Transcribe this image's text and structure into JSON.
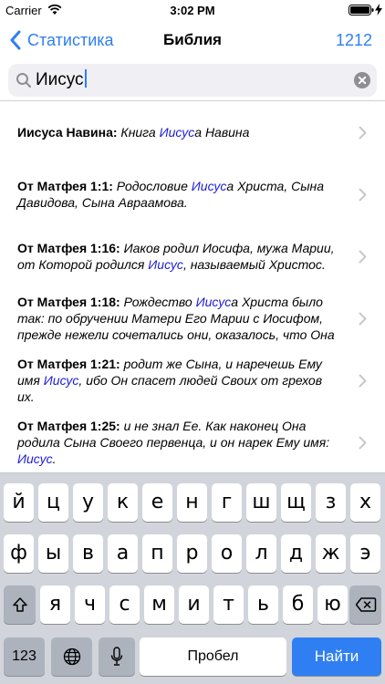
{
  "status": {
    "carrier": "Carrier",
    "time": "3:02 PM",
    "icons": [
      "wifi-icon",
      "battery-icon",
      "charging-icon"
    ]
  },
  "nav": {
    "back_label": "Статистика",
    "title": "Библия",
    "count": "1212"
  },
  "search": {
    "value": "Иисус",
    "icons": [
      "search-icon",
      "clear-icon"
    ]
  },
  "results": [
    {
      "ref": "Иисуса Навина:",
      "lines": [
        [
          {
            "t": " Книга ",
            "hl": false
          },
          {
            "t": "Иисус",
            "hl": true
          },
          {
            "t": "а Навина",
            "hl": false
          }
        ]
      ]
    },
    {
      "ref": "От Матфея 1:1:",
      "lines": [
        [
          {
            "t": " Родословие ",
            "hl": false
          },
          {
            "t": "Иисус",
            "hl": true
          },
          {
            "t": "а Христа, Сына",
            "hl": false
          }
        ],
        [
          {
            "t": "Давидова, Сына Авраамова.",
            "hl": false
          }
        ]
      ]
    },
    {
      "ref": "От Матфея 1:16:",
      "lines": [
        [
          {
            "t": " Иаков родил Иосифа, мужа Марии,",
            "hl": false
          }
        ],
        [
          {
            "t": "от Которой родился ",
            "hl": false
          },
          {
            "t": "Иисус",
            "hl": true
          },
          {
            "t": ", называемый Христос.",
            "hl": false
          }
        ]
      ]
    },
    {
      "ref": "От Матфея 1:18:",
      "lines": [
        [
          {
            "t": " Рождество ",
            "hl": false
          },
          {
            "t": "Иисус",
            "hl": true
          },
          {
            "t": "а Христа было",
            "hl": false
          }
        ],
        [
          {
            "t": "так: по обручении Матери Его Марии с Иосифом,",
            "hl": false
          }
        ],
        [
          {
            "t": "прежде нежели сочетались они, оказалось, что Она",
            "hl": false
          }
        ]
      ]
    },
    {
      "ref": "От Матфея 1:21:",
      "lines": [
        [
          {
            "t": " родит же Сына, и наречешь Ему",
            "hl": false
          }
        ],
        [
          {
            "t": "имя ",
            "hl": false
          },
          {
            "t": "Иисус",
            "hl": true
          },
          {
            "t": ", ибо Он спасет людей Своих от грехов",
            "hl": false
          }
        ],
        [
          {
            "t": "их.",
            "hl": false
          }
        ]
      ]
    },
    {
      "ref": "От Матфея 1:25:",
      "lines": [
        [
          {
            "t": " и не знал Ее. Как наконец Она",
            "hl": false
          }
        ],
        [
          {
            "t": "родила Сына Своего первенца, и он нарек Ему имя:",
            "hl": false
          }
        ],
        [
          {
            "t": "Иисус",
            "hl": true
          },
          {
            "t": ".",
            "hl": false
          }
        ]
      ]
    }
  ],
  "keyboard": {
    "row1": [
      "й",
      "ц",
      "у",
      "к",
      "е",
      "н",
      "г",
      "ш",
      "щ",
      "з",
      "х"
    ],
    "row2": [
      "ф",
      "ы",
      "в",
      "а",
      "п",
      "р",
      "о",
      "л",
      "д",
      "ж",
      "э"
    ],
    "row3": [
      "я",
      "ч",
      "с",
      "м",
      "и",
      "т",
      "ь",
      "б",
      "ю"
    ],
    "numbers_label": "123",
    "space_label": "Пробел",
    "action_label": "Найти",
    "icons": [
      "shift-icon",
      "backspace-icon",
      "globe-icon",
      "microphone-icon"
    ]
  },
  "colors": {
    "accent": "#2f7ff2",
    "highlight": "#1d1dd6",
    "keyboard_bg": "#d1d4da"
  }
}
